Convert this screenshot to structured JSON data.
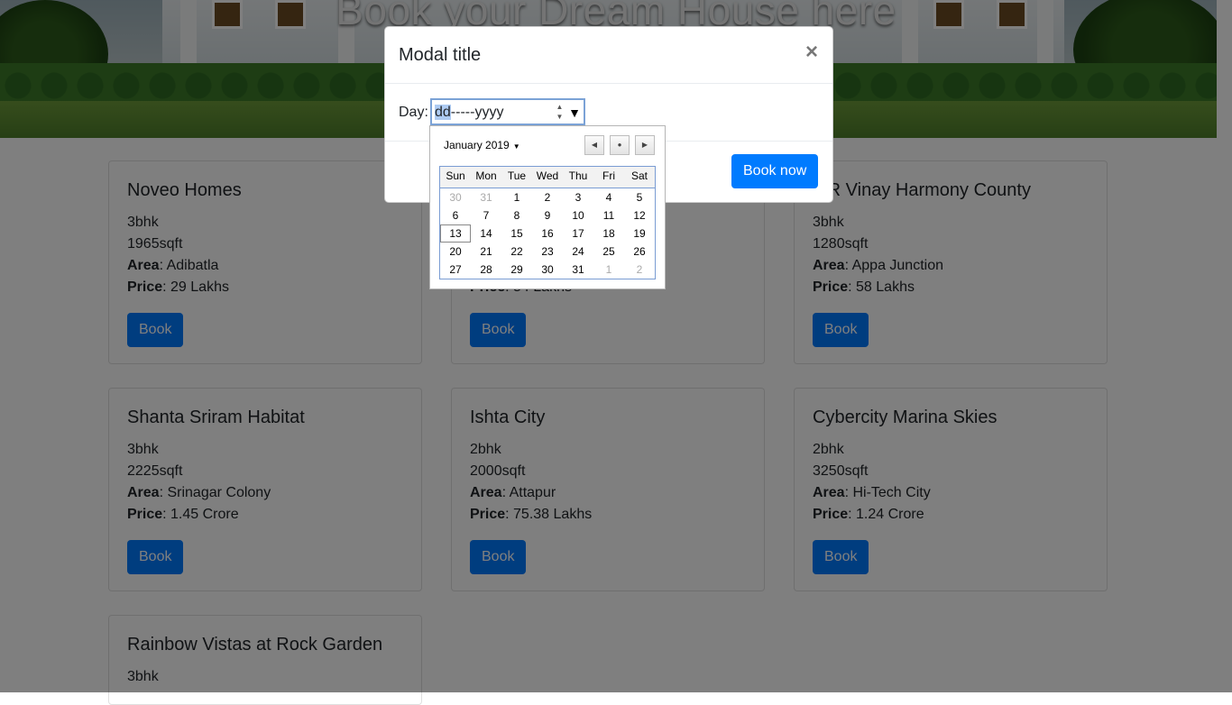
{
  "hero": {
    "title": "Book your Dream House here"
  },
  "cards": [
    {
      "name": "Noveo Homes",
      "bhk": "3bhk",
      "sqft": "1965sqft",
      "area_label": "Area",
      "area": "Adibatla",
      "price_label": "Price",
      "price": "29 Lakhs",
      "button": "Book"
    },
    {
      "name": "",
      "bhk": "",
      "sqft": "",
      "area_label": "",
      "area": "",
      "price_label": "Price",
      "price": "54 Lakhs",
      "button": "Book"
    },
    {
      "name": "MR Vinay Harmony County",
      "bhk": "3bhk",
      "sqft": "1280sqft",
      "area_label": "Area",
      "area": "Appa Junction",
      "price_label": "Price",
      "price": "58 Lakhs",
      "button": "Book"
    },
    {
      "name": "Shanta Sriram Habitat",
      "bhk": "3bhk",
      "sqft": "2225sqft",
      "area_label": "Area",
      "area": "Srinagar Colony",
      "price_label": "Price",
      "price": "1.45 Crore",
      "button": "Book"
    },
    {
      "name": "Ishta City",
      "bhk": "2bhk",
      "sqft": "2000sqft",
      "area_label": "Area",
      "area": "Attapur",
      "price_label": "Price",
      "price": "75.38 Lakhs",
      "button": "Book"
    },
    {
      "name": "Cybercity Marina Skies",
      "bhk": "2bhk",
      "sqft": "3250sqft",
      "area_label": "Area",
      "area": "Hi-Tech City",
      "price_label": "Price",
      "price": "1.24 Crore",
      "button": "Book"
    },
    {
      "name": "Rainbow Vistas at Rock Garden",
      "bhk": "3bhk",
      "sqft": "",
      "area_label": "",
      "area": "",
      "price_label": "",
      "price": "",
      "button": ""
    }
  ],
  "modal": {
    "title": "Modal title",
    "close": "×",
    "day_label": "Day:",
    "date_input": {
      "selected": "dd",
      "rest": "-----yyyy"
    },
    "book_now": "Book now"
  },
  "calendar": {
    "month_label": "January 2019",
    "weekdays": [
      "Sun",
      "Mon",
      "Tue",
      "Wed",
      "Thu",
      "Fri",
      "Sat"
    ],
    "weeks": [
      [
        "30",
        "31",
        "1",
        "2",
        "3",
        "4",
        "5"
      ],
      [
        "6",
        "7",
        "8",
        "9",
        "10",
        "11",
        "12"
      ],
      [
        "13",
        "14",
        "15",
        "16",
        "17",
        "18",
        "19"
      ],
      [
        "20",
        "21",
        "22",
        "23",
        "24",
        "25",
        "26"
      ],
      [
        "27",
        "28",
        "29",
        "30",
        "31",
        "1",
        "2"
      ]
    ],
    "today": "13",
    "icons": {
      "prev": "triangle-left-icon",
      "today": "dot-icon",
      "next": "triangle-right-icon"
    }
  }
}
